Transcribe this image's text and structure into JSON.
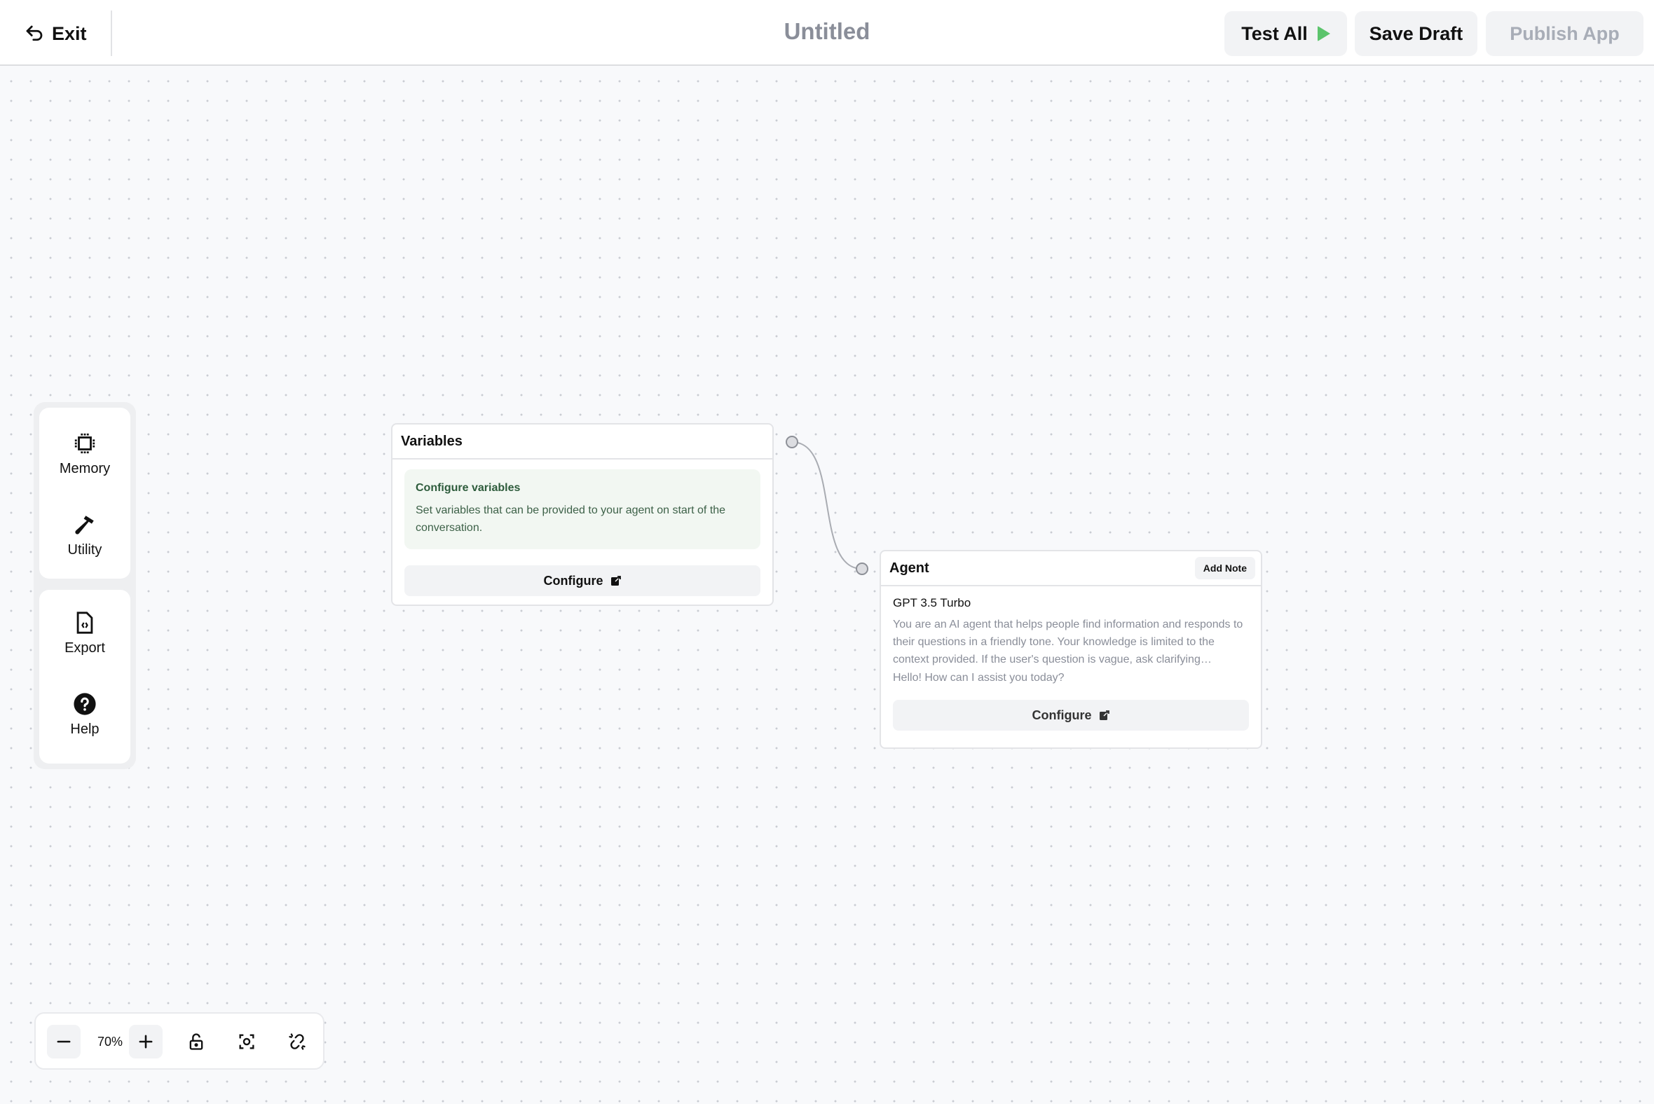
{
  "header": {
    "exit_label": "Exit",
    "exit_icon": "undo-arrow-icon",
    "title": "Untitled",
    "buttons": {
      "test_all": "Test All",
      "save_draft": "Save Draft",
      "publish_app": "Publish App"
    },
    "colors": {
      "play_icon": "#5cc46c",
      "publish_disabled_text": "#a8adb7"
    }
  },
  "sidebar": {
    "groups": [
      {
        "items": [
          {
            "label": "Memory",
            "icon": "cpu-chip-icon"
          },
          {
            "label": "Utility",
            "icon": "hammer-icon"
          }
        ]
      },
      {
        "items": [
          {
            "label": "Export",
            "icon": "code-file-icon"
          },
          {
            "label": "Help",
            "icon": "question-circle-icon"
          }
        ]
      }
    ]
  },
  "nodes": {
    "variables": {
      "title": "Variables",
      "info_title": "Configure variables",
      "info_text": "Set variables that can be provided to your agent on start of the conversation.",
      "configure_label": "Configure"
    },
    "agent": {
      "title": "Agent",
      "add_note_label": "Add Note",
      "model": "GPT 3.5 Turbo",
      "prompt": "You are an AI agent that helps people find information and responds to their questions in a friendly tone. Your knowledge is limited to the context provided. If the user's question is vague, ask clarifying questions.",
      "greeting": "Hello! How can I assist you today?",
      "configure_label": "Configure"
    },
    "edges": [
      {
        "from": "variables",
        "to": "agent"
      }
    ]
  },
  "zoom_controls": {
    "zoom_level": "70%",
    "icons": [
      "minus-icon",
      "plus-icon",
      "unlock-icon",
      "fit-view-icon",
      "unlink-icon"
    ]
  }
}
